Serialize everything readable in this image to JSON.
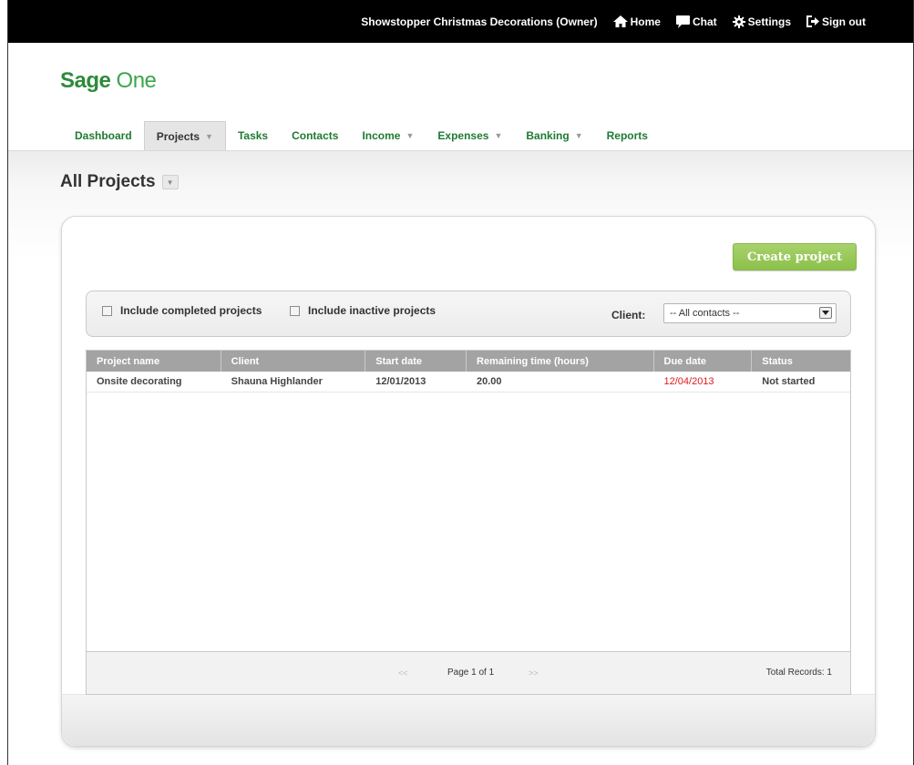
{
  "topbar": {
    "company": "Showstopper Christmas Decorations (Owner)",
    "home": "Home",
    "chat": "Chat",
    "settings": "Settings",
    "signout": "Sign out"
  },
  "logo": {
    "bold": "Sage",
    "light": " One"
  },
  "nav": {
    "tabs": [
      {
        "label": "Dashboard",
        "dropdown": false
      },
      {
        "label": "Projects",
        "dropdown": true,
        "active": true
      },
      {
        "label": "Tasks",
        "dropdown": false
      },
      {
        "label": "Contacts",
        "dropdown": false
      },
      {
        "label": "Income",
        "dropdown": true
      },
      {
        "label": "Expenses",
        "dropdown": true
      },
      {
        "label": "Banking",
        "dropdown": true
      },
      {
        "label": "Reports",
        "dropdown": false
      }
    ],
    "caret": "▼"
  },
  "page": {
    "title": "All Projects",
    "title_dd": "▼"
  },
  "actions": {
    "create_project": "Create project"
  },
  "filters": {
    "include_completed": "Include completed projects",
    "include_inactive": "Include inactive projects",
    "client_label": "Client:",
    "client_value": "-- All contacts --"
  },
  "table": {
    "columns": [
      "Project name",
      "Client",
      "Start date",
      "Remaining time (hours)",
      "Due date",
      "Status"
    ],
    "rows": [
      [
        "Onsite decorating",
        "Shauna Highlander",
        "12/01/2013",
        "20.00",
        "12/04/2013",
        "Not started"
      ]
    ]
  },
  "pager": {
    "prev": "<<",
    "info": "Page 1 of 1",
    "next": ">>",
    "total": "Total Records: 1"
  },
  "colors": {
    "brand": "#2e8b3b",
    "button": "#8cc04a",
    "due": "#e01b1b",
    "header": "#a3a3a3"
  }
}
